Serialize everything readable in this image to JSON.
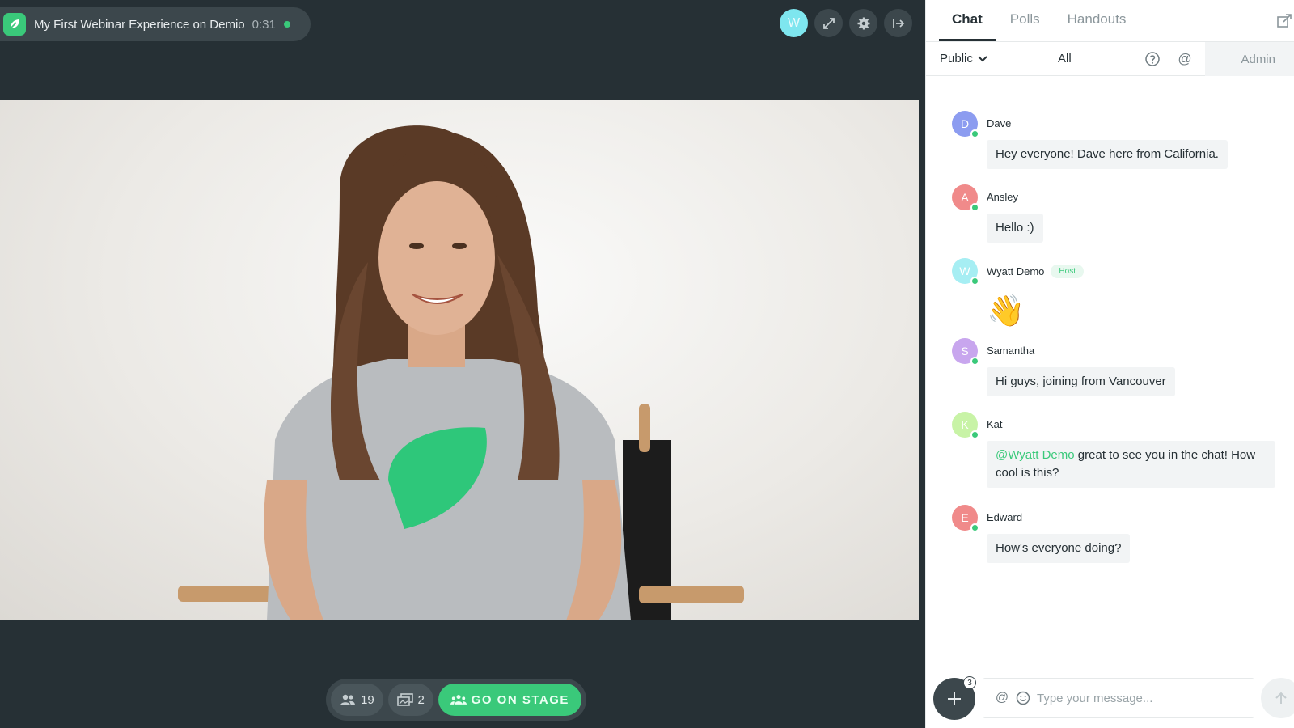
{
  "header": {
    "title": "My First Webinar Experience on Demio",
    "timer": "0:31",
    "avatar_initial": "W"
  },
  "bottom_bar": {
    "attendee_count": "19",
    "room_count": "2",
    "go_on_stage_label": "GO ON STAGE"
  },
  "chat_panel": {
    "tabs": [
      {
        "label": "Chat",
        "active": true
      },
      {
        "label": "Polls",
        "active": false
      },
      {
        "label": "Handouts",
        "active": false
      }
    ],
    "filters": {
      "visibility": "Public",
      "scope": "All",
      "admin_label": "Admin"
    },
    "messages": [
      {
        "initial": "D",
        "name": "Dave",
        "avatar_color": "#8c9cf0",
        "text": "Hey everyone! Dave here from California."
      },
      {
        "initial": "A",
        "name": "Ansley",
        "avatar_color": "#f08a8a",
        "text": "Hello :)"
      },
      {
        "initial": "W",
        "name": "Wyatt Demo",
        "avatar_color": "#a6eef3",
        "badge": "Host",
        "emoji": "👋"
      },
      {
        "initial": "S",
        "name": "Samantha",
        "avatar_color": "#c8a6ee",
        "text": "Hi guys, joining from Vancouver"
      },
      {
        "initial": "K",
        "name": "Kat",
        "avatar_color": "#c8f3a6",
        "mention": "@Wyatt Demo",
        "text": " great to see you in the chat! How cool is this?"
      },
      {
        "initial": "E",
        "name": "Edward",
        "avatar_color": "#f08a8a",
        "text": "How's everyone doing?"
      }
    ],
    "composer": {
      "placeholder": "Type your message...",
      "notification_count": "3"
    }
  },
  "colors": {
    "accent": "#3ac97a",
    "dark_bg": "#263035",
    "control_bg": "#3c474c"
  }
}
